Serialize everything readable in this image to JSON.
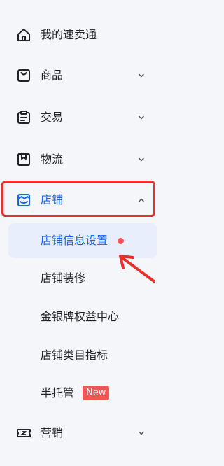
{
  "sidebar": {
    "items": [
      {
        "label": "我的速卖通",
        "icon": "home-icon"
      },
      {
        "label": "商品",
        "icon": "bag-icon"
      },
      {
        "label": "交易",
        "icon": "clipboard-icon"
      },
      {
        "label": "物流",
        "icon": "package-icon"
      },
      {
        "label": "店铺",
        "icon": "store-icon"
      },
      {
        "label": "营销",
        "icon": "ticket-icon"
      }
    ],
    "store_submenu": [
      {
        "label": "店铺信息设置",
        "active": true
      },
      {
        "label": "店铺装修"
      },
      {
        "label": "金银牌权益中心"
      },
      {
        "label": "店铺类目指标"
      },
      {
        "label": "半托管",
        "badge": "New"
      }
    ]
  },
  "colors": {
    "accent": "#1664ff",
    "active_bg": "#e9eefc",
    "notice_red": "#f25555",
    "annotation_red": "#e8312d"
  }
}
